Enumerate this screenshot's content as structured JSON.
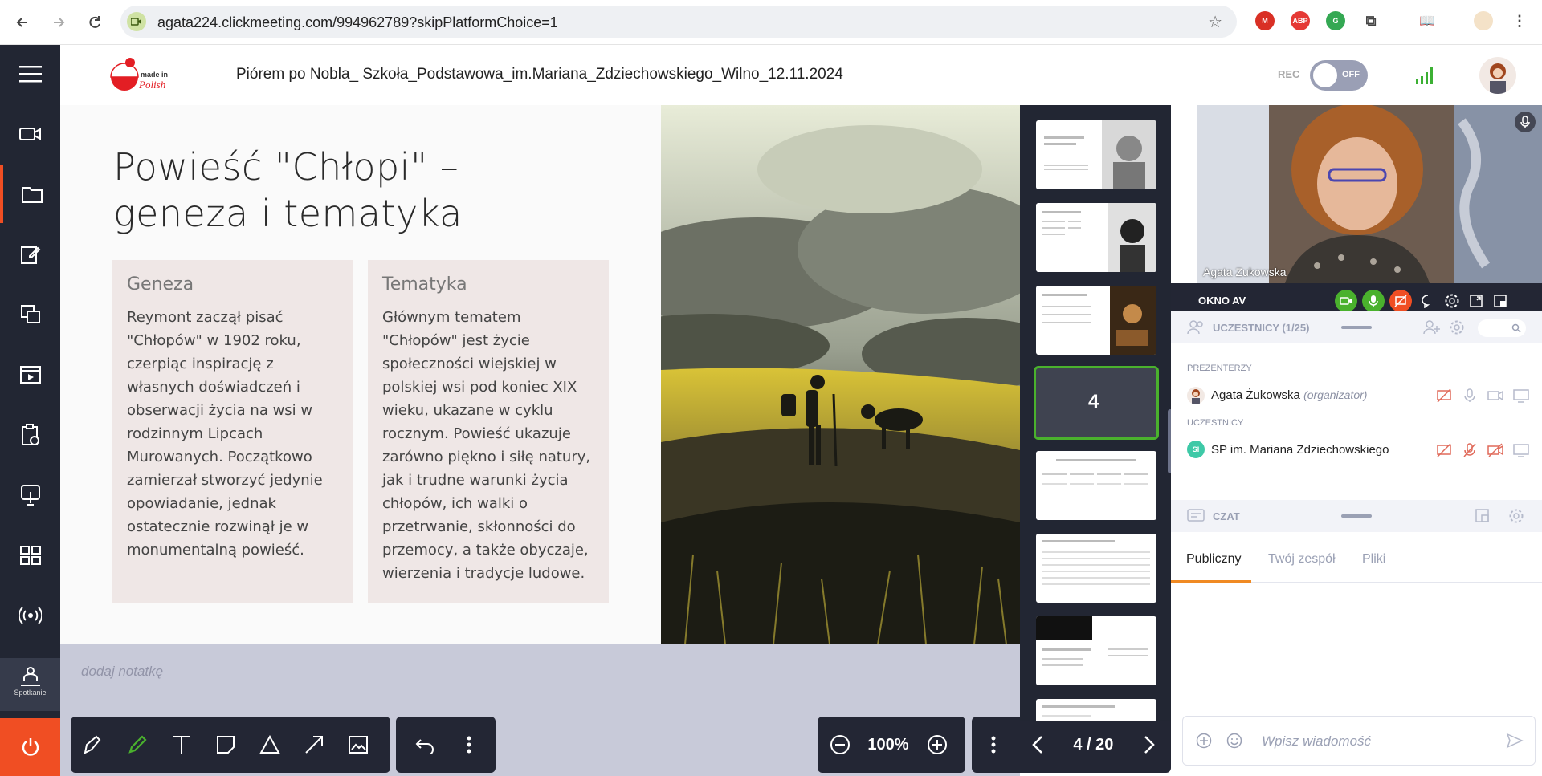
{
  "browser": {
    "url": "agata224.clickmeeting.com/994962789?skipPlatformChoice=1",
    "extensions": [
      "gmail-icon",
      "adblock-icon",
      "tag-icon",
      "puzzle-icon"
    ]
  },
  "sidebar": {
    "meeting_label": "Spotkanie"
  },
  "header": {
    "title": "Piórem po Nobla_ Szkoła_Podstawowa_im.Mariana_Zdziechowskiego_Wilno_12.11.2024",
    "rec_label": "REC",
    "rec_toggle": "OFF"
  },
  "slide": {
    "title": "Powieść \"Chłopi\" – geneza i tematyka",
    "card1_title": "Geneza",
    "card1_text": "Reymont zaczął pisać \"Chłopów\" w 1902 roku, czerpiąc inspirację z własnych doświadczeń i obserwacji życia na wsi w rodzinnym Lipcach Murowanych. Początkowo zamierzał stworzyć jedynie opowiadanie, jednak ostatecznie rozwinął je w monumentalną powieść.",
    "card2_title": "Tematyka",
    "card2_text": "Głównym tematem \"Chłopów\" jest życie społeczności wiejskiej w polskiej wsi pod koniec XIX wieku, ukazane w cyklu rocznym. Powieść ukazuje zarówno piękno i siłę natury, jak i trudne warunki życia chłopów, ich walki o przetrwanie, skłonności do przemocy, a także obyczaje, wierzenia i tradycje ludowe."
  },
  "notes": {
    "placeholder": "dodaj notatkę"
  },
  "toolbar": {
    "zoom": "100%",
    "page": "4 / 20"
  },
  "thumbs": {
    "current_number": "4"
  },
  "video": {
    "name": "Agata Zukowska",
    "av_label": "OKNO AV"
  },
  "participants": {
    "title": "UCZESTNICY (1/25)",
    "presenters_label": "PREZENTERZY",
    "presenter_name": "Agata Żukowska",
    "presenter_role": "(organizator)",
    "attendees_label": "UCZESTNICY",
    "attendee_initials": "SI",
    "attendee_name": "SP im. Mariana Zdziechowskiego"
  },
  "chat": {
    "title": "CZAT",
    "tabs": [
      "Publiczny",
      "Twój zespół",
      "Pliki"
    ],
    "input_placeholder": "Wpisz wiadomość"
  },
  "colors": {
    "accent": "#f04e23",
    "sidebar": "#222633",
    "active_green": "#4ab12d",
    "tab_underline": "#f08a23"
  }
}
